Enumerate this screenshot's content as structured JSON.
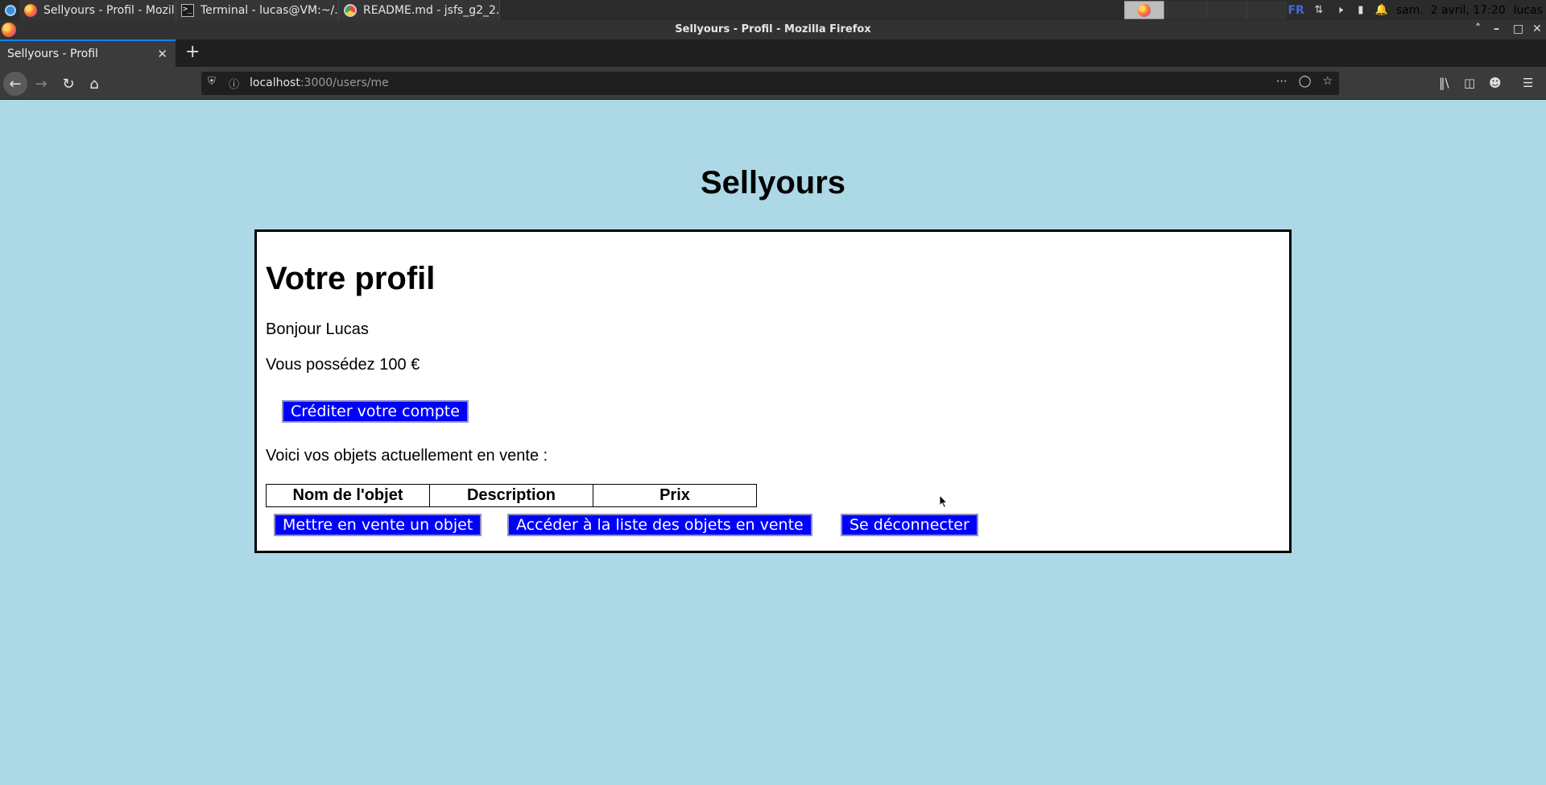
{
  "taskbar": {
    "tasks": [
      {
        "label": "Sellyours - Profil - Mozil..."
      },
      {
        "label": "Terminal - lucas@VM:~/..."
      },
      {
        "label": "README.md - jsfs_g2_2..."
      }
    ],
    "keyboard_layout": "FR",
    "clock": "sam.  2 avril, 17:20",
    "user": "lucas"
  },
  "window": {
    "title": "Sellyours - Profil - Mozilla Firefox"
  },
  "browser": {
    "tab_label": "Sellyours - Profil",
    "url_host": "localhost",
    "url_rest": ":3000/users/me"
  },
  "page": {
    "site_title": "Sellyours",
    "heading": "Votre profil",
    "greeting": "Bonjour Lucas",
    "balance": "Vous possédez 100 €",
    "credit_button": "Créditer votre compte",
    "items_intro": "Voici vos objets actuellement en vente :",
    "table_headers": [
      "Nom de l'objet",
      "Description",
      "Prix"
    ],
    "sell_button": "Mettre en vente un objet",
    "list_button": "Accéder à la liste des objets en vente",
    "logout_button": "Se déconnecter"
  },
  "colors": {
    "page_background": "#add8e6",
    "button_background": "#0000ff",
    "button_text": "#ffffff"
  }
}
